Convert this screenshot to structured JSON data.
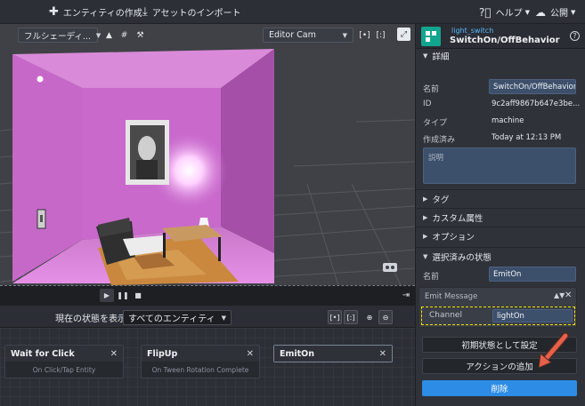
{
  "topbar": {
    "create_entity": "エンティティの作成",
    "import_asset": "アセットのインポート",
    "help": "ヘルプ",
    "publish": "公開"
  },
  "viewport": {
    "shading_mode": "フルシェーディ...",
    "camera": "Editor Cam"
  },
  "state_bar": {
    "label": "現在の状態を表示",
    "entity_filter": "すべてのエンティティ"
  },
  "graph": {
    "nodes": [
      {
        "title": "Wait for Click",
        "event": "On Click/Tap Entity"
      },
      {
        "title": "FlipUp",
        "event": "On Tween Rotation Complete"
      },
      {
        "title": "EmitOn",
        "event": ""
      }
    ]
  },
  "panel": {
    "entity_subtitle": "light_switch",
    "entity_name": "SwitchOn/OffBehavior",
    "details": {
      "header": "詳細",
      "name_label": "名前",
      "name_value": "SwitchOn/OffBehavior",
      "id_label": "ID",
      "id_value": "9c2aff9867b647e3be...",
      "type_label": "タイプ",
      "type_value": "machine",
      "created_label": "作成済み",
      "created_value": "Today at 12:13 PM",
      "description_placeholder": "説明"
    },
    "sections": {
      "tags": "タグ",
      "custom_attributes": "カスタム属性",
      "options": "オプション",
      "selected_state": "選択済みの状態"
    },
    "state": {
      "name_label": "名前",
      "name_value": "EmitOn"
    },
    "emit_message": {
      "title": "Emit Message",
      "channel_label": "Channel",
      "channel_value": "lightOn"
    },
    "buttons": {
      "set_initial": "初期状態として設定",
      "add_action": "アクションの追加",
      "delete": "削除"
    }
  },
  "colors": {
    "accent_blue": "#2d8ce6",
    "highlight_yellow": "#f2e400",
    "annotation_arrow": "#e8604a",
    "room_pink": "#d67ad8",
    "entity_icon": "#11a58e"
  }
}
